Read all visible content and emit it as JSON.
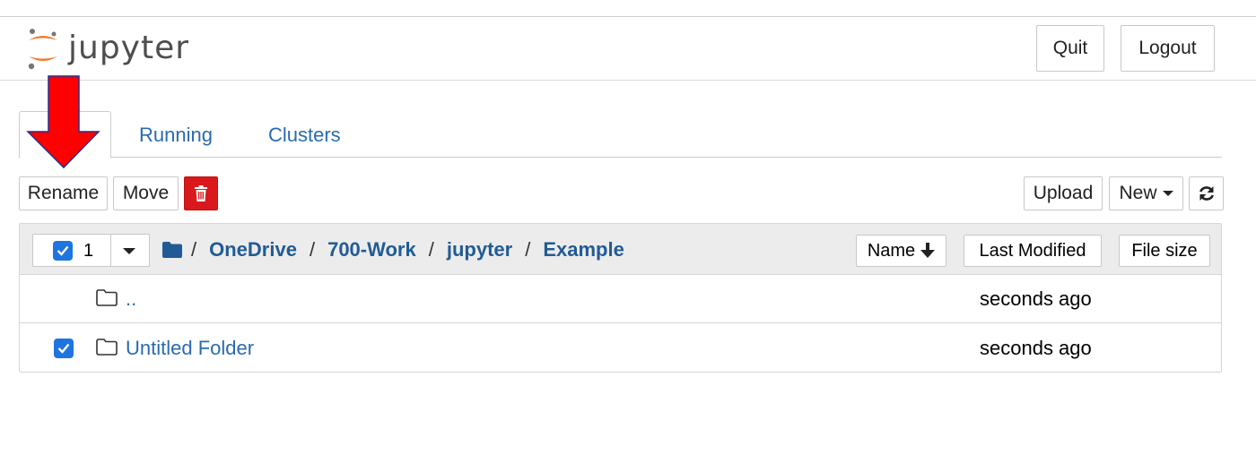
{
  "header": {
    "logo_text": "jupyter",
    "quit_label": "Quit",
    "logout_label": "Logout"
  },
  "tabs": [
    {
      "label": "",
      "active": true
    },
    {
      "label": "Running",
      "active": false
    },
    {
      "label": "Clusters",
      "active": false
    }
  ],
  "toolbar": {
    "rename_label": "Rename",
    "move_label": "Move",
    "delete_icon": "trash-icon",
    "upload_label": "Upload",
    "new_label": "New",
    "refresh_icon": "refresh-icon"
  },
  "list_header": {
    "selected_count": "1",
    "breadcrumb": [
      "OneDrive",
      "700-Work",
      "jupyter",
      "Example"
    ],
    "separator": "/",
    "sort_name_label": "Name",
    "sort_modified_label": "Last Modified",
    "sort_size_label": "File size"
  },
  "rows": [
    {
      "name": "..",
      "modified": "seconds ago",
      "checked": false
    },
    {
      "name": "Untitled Folder",
      "modified": "seconds ago",
      "checked": true
    }
  ],
  "colors": {
    "link": "#2a6bb0",
    "breadcrumb": "#215b96",
    "checkbox": "#1e74e0",
    "delete": "#d9191b",
    "annotation_arrow": "#ff0000",
    "logo_orange": "#f37726"
  }
}
